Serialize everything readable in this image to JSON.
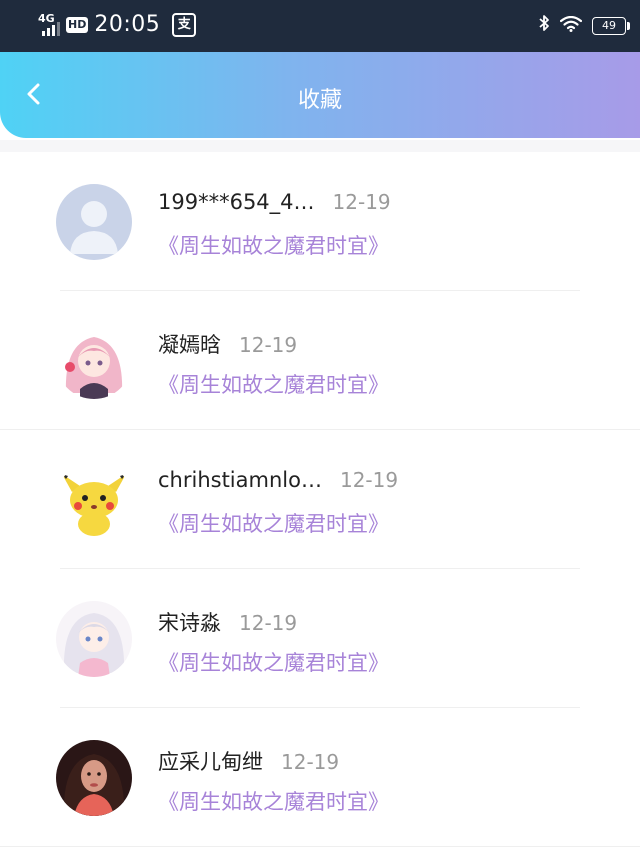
{
  "status_bar": {
    "network": "4G",
    "hd": "HD",
    "time": "20:05",
    "pay_icon_char": "支",
    "battery": "49"
  },
  "header": {
    "title": "收藏",
    "gradient": [
      "#4fd2f5",
      "#a79be8"
    ]
  },
  "items": [
    {
      "name": "199***654_4…",
      "date": "12-19",
      "book": "《周生如故之魔君时宜》",
      "avatar": "default-avatar"
    },
    {
      "name": "凝嫣晗",
      "date": "12-19",
      "book": "《周生如故之魔君时宜》",
      "avatar": "anime-girl-pink"
    },
    {
      "name": "chrihstiamnlo…",
      "date": "12-19",
      "book": "《周生如故之魔君时宜》",
      "avatar": "pikachu"
    },
    {
      "name": "宋诗淼",
      "date": "12-19",
      "book": "《周生如故之魔君时宜》",
      "avatar": "anime-girl-white"
    },
    {
      "name": "应采儿甸绁",
      "date": "12-19",
      "book": "《周生如故之魔君时宜》",
      "avatar": "photo-woman"
    }
  ],
  "colors": {
    "book_link": "#a783d8",
    "date": "#9a9a9a"
  }
}
